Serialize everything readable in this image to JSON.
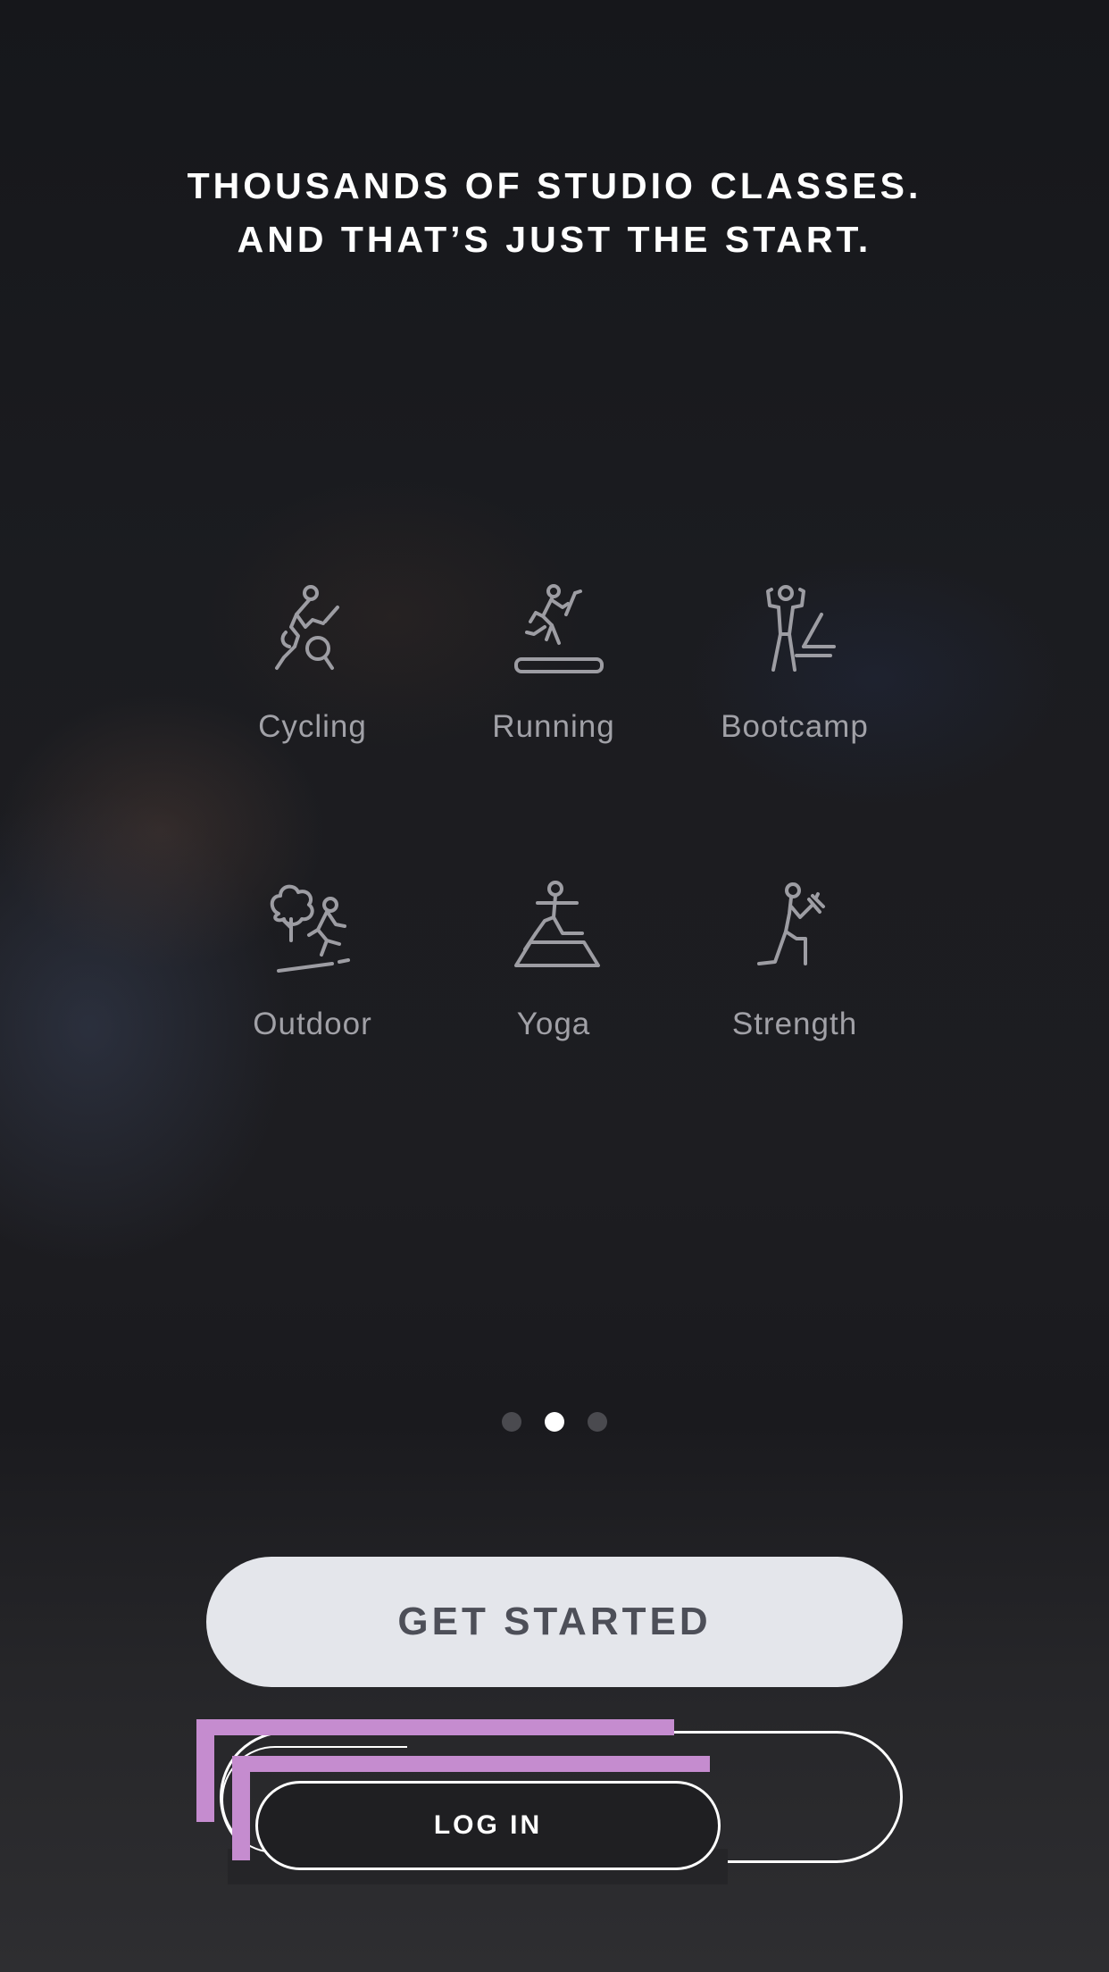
{
  "headline": {
    "line1": "THOUSANDS OF STUDIO CLASSES.",
    "line2": "AND THAT’S JUST THE START."
  },
  "categories": [
    {
      "label": "Cycling",
      "icon": "cycling-icon"
    },
    {
      "label": "Running",
      "icon": "running-icon"
    },
    {
      "label": "Bootcamp",
      "icon": "bootcamp-icon"
    },
    {
      "label": "Outdoor",
      "icon": "outdoor-icon"
    },
    {
      "label": "Yoga",
      "icon": "yoga-icon"
    },
    {
      "label": "Strength",
      "icon": "strength-icon"
    }
  ],
  "pagination": {
    "total": 3,
    "active_index": 1
  },
  "actions": {
    "get_started_label": "GET STARTED",
    "login_label": "LOG IN"
  },
  "colors": {
    "background": "#17171b",
    "primary_button": "#e4e6eb",
    "primary_button_text": "#4d4f58",
    "icon_stroke": "#9d9da3",
    "active_dot": "#ffffff",
    "inactive_dot": "#4a4a4f"
  }
}
